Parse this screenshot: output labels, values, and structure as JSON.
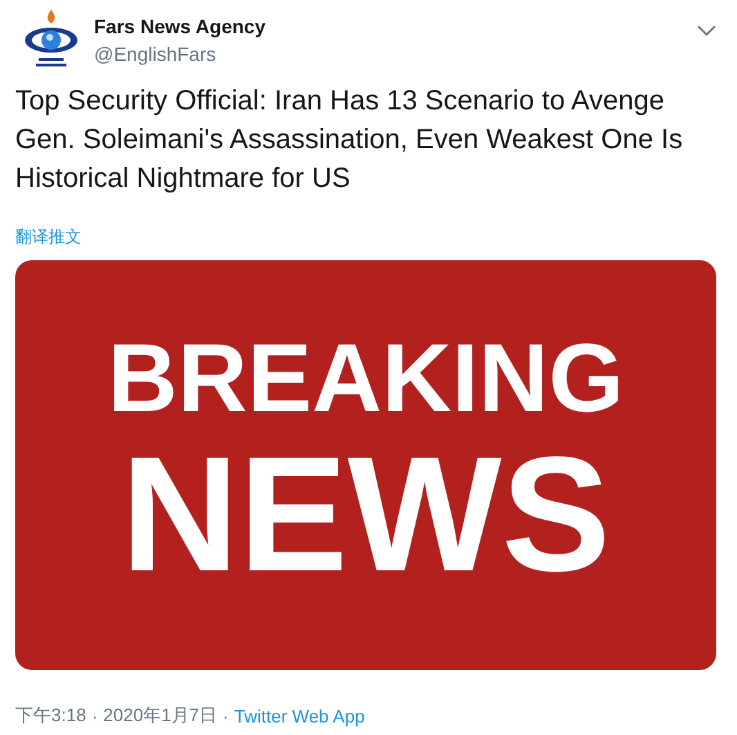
{
  "author": {
    "name": "Fars News Agency",
    "handle": "@EnglishFars"
  },
  "tweet": {
    "text": "Top Security Official: Iran Has 13 Scenario to Avenge Gen. Soleimani's Assassination, Even Weakest One Is Historical Nightmare for US",
    "translate_link": "翻译推文"
  },
  "media": {
    "lines": [
      "BREAKING",
      "NEWS"
    ]
  },
  "footer": {
    "time": "下午3:18",
    "separator_1": "·",
    "date": "2020年1月7日",
    "separator_2": "·",
    "source": "Twitter Web App"
  }
}
